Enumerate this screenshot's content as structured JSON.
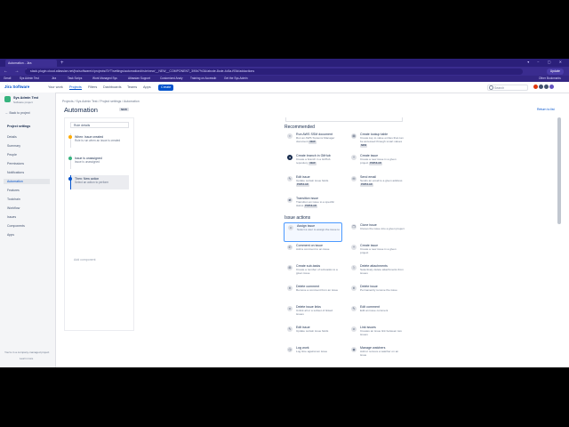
{
  "browser": {
    "tab_title": "Automation - Jira",
    "url": "stack.plugin.cloud.atlassian.net/jira/software/c/projects/SYT/settings/automation#/rule/new/__NEW__COMPONENT_3/f0b7%3A/abcde-8cde-4c5a-f93d/addactions",
    "update_label": "Update",
    "bookmarks": [
      "Gmail",
      "Sys Admin Test",
      "Jira",
      "Task Scrips",
      "Work Managed Sys",
      "Atlassian Support",
      "Customized Analy",
      "Training on Accessib",
      "Get the Sys.Admin",
      "Other Bookmarks"
    ]
  },
  "nav": {
    "logo": "Jira Software",
    "items": [
      "Your work",
      "Projects",
      "Filters",
      "Dashboards",
      "Teams",
      "Apps"
    ],
    "create_label": "Create",
    "search_placeholder": "Search"
  },
  "sidebar": {
    "project_name": "Sys Admin Test",
    "project_type": "Software project",
    "back_label": "Back to project",
    "section_title": "Project settings",
    "items": [
      "Details",
      "Summary",
      "People",
      "Permissions",
      "Notifications",
      "Automation",
      "Features",
      "Toolchain",
      "Workflow",
      "Issues",
      "Components",
      "Apps"
    ],
    "footer": "You're in a company-managed project",
    "learn_more": "Learn more"
  },
  "main": {
    "breadcrumb": "Projects  /  Sys Admin Test  /  Project settings  /  Automation",
    "title": "Automation",
    "new_badge": "NEW",
    "return_link": "Return to list",
    "rule": {
      "name_placeholder": "Rule details",
      "steps": [
        {
          "title": "When: Issue created",
          "sub": "Rule is run when an issue is created"
        },
        {
          "title": "Issue is unassigned",
          "sub": "Issue is unassigned"
        },
        {
          "title": "Then: New action",
          "sub": "Select an action to perform"
        }
      ],
      "add_component": "Add component"
    },
    "recommended_heading": "Recommended",
    "issue_actions_heading": "Issue actions",
    "recommended": [
      {
        "title": "Run AWS SSM document",
        "desc": "Run an AWS Systems Manager document",
        "badge": "NEW"
      },
      {
        "title": "Create lookup table",
        "desc": "Create key to value entries that can be accessed through smart values",
        "badge": "NEW"
      },
      {
        "title": "Create branch in GitHub",
        "desc": "Create a branch in a GitHub repository",
        "badge": "NEW"
      },
      {
        "title": "Create issue",
        "desc": "Create a new issue in a given project",
        "badge": "POPULAR"
      },
      {
        "title": "Edit issue",
        "desc": "Update certain issue fields",
        "badge": "POPULAR"
      },
      {
        "title": "Send email",
        "desc": "Sends an email to a given address",
        "badge": "POPULAR"
      },
      {
        "title": "Transition issue",
        "desc": "Transition an issue to a specific status",
        "badge": "POPULAR"
      }
    ],
    "issue_actions": [
      {
        "title": "Assign issue",
        "desc": "Select a user to assign the issue to"
      },
      {
        "title": "Clone issue",
        "desc": "Clones the issue into a given project"
      },
      {
        "title": "Comment on issue",
        "desc": "Add a comment to an issue"
      },
      {
        "title": "Create issue",
        "desc": "Create a new issue in a given project"
      },
      {
        "title": "Create sub-tasks",
        "desc": "Create a number of sub-tasks to a given issue"
      },
      {
        "title": "Delete attachments",
        "desc": "Selectively delete attachments from issues"
      },
      {
        "title": "Delete comment",
        "desc": "Remove a comment from an issue"
      },
      {
        "title": "Delete issue",
        "desc": "Permanently remove the issue"
      },
      {
        "title": "Delete issue links",
        "desc": "Unlink all or a subset of linked issues"
      },
      {
        "title": "Edit comment",
        "desc": "Edit an issue comment"
      },
      {
        "title": "Edit issue",
        "desc": "Update certain issue fields"
      },
      {
        "title": "Link issues",
        "desc": "Creates an issue link between two issues"
      },
      {
        "title": "Log work",
        "desc": "Log time against an issue"
      },
      {
        "title": "Manage watchers",
        "desc": "Add or remove a watcher on an issue"
      }
    ]
  },
  "colors": {
    "accent": "#0052cc",
    "browser_chrome": "#2b1f7a"
  }
}
